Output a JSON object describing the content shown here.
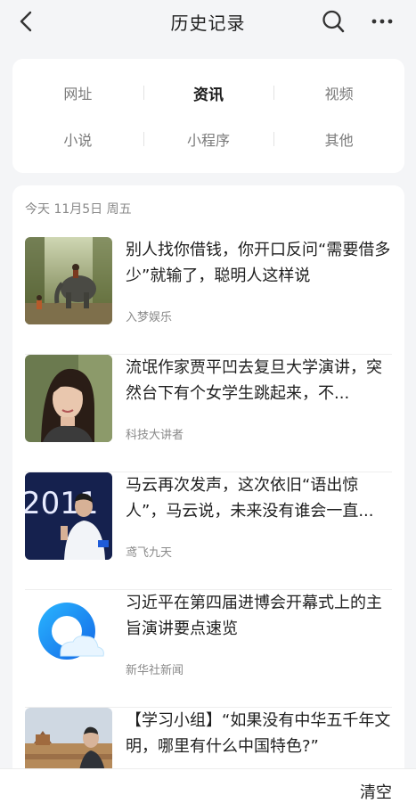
{
  "header": {
    "title": "历史记录",
    "back_icon": "back-arrow-icon",
    "search_icon": "search-icon",
    "more_icon": "more-dots-icon"
  },
  "categories": [
    {
      "label": "网址",
      "active": false
    },
    {
      "label": "资讯",
      "active": true
    },
    {
      "label": "视频",
      "active": false
    },
    {
      "label": "小说",
      "active": false
    },
    {
      "label": "小程序",
      "active": false
    },
    {
      "label": "其他",
      "active": false
    }
  ],
  "feed": {
    "date_label": "今天 11月5日 周五",
    "items": [
      {
        "title": "别人找你借钱，你开口反问“需要借多少”就输了，聪明人这样说",
        "source": "入梦娱乐",
        "thumb": "elephant-photo"
      },
      {
        "title": "流氓作家贾平凹去复旦大学演讲，突然台下有个女学生跳起来，不...",
        "source": "科技大讲者",
        "thumb": "woman-portrait-photo"
      },
      {
        "title": "马云再次发声，这次依旧“语出惊人”，马云说，未来没有谁会一直...",
        "source": "鸢飞九天",
        "thumb": "speaker-stage-photo"
      },
      {
        "title": "习近平在第四届进博会开幕式上的主旨演讲要点速览",
        "source": "新华社新闻",
        "thumb": "qq-browser-logo"
      },
      {
        "title": "【学习小组】“如果没有中华五千年文明，哪里有什么中国特色?”",
        "source": "",
        "thumb": "great-wall-photo"
      }
    ]
  },
  "footer": {
    "clear_label": "清空"
  },
  "colors": {
    "background": "#f4f5f7",
    "card": "#ffffff",
    "active_text": "#1a1a1a",
    "muted_text": "#888888"
  }
}
